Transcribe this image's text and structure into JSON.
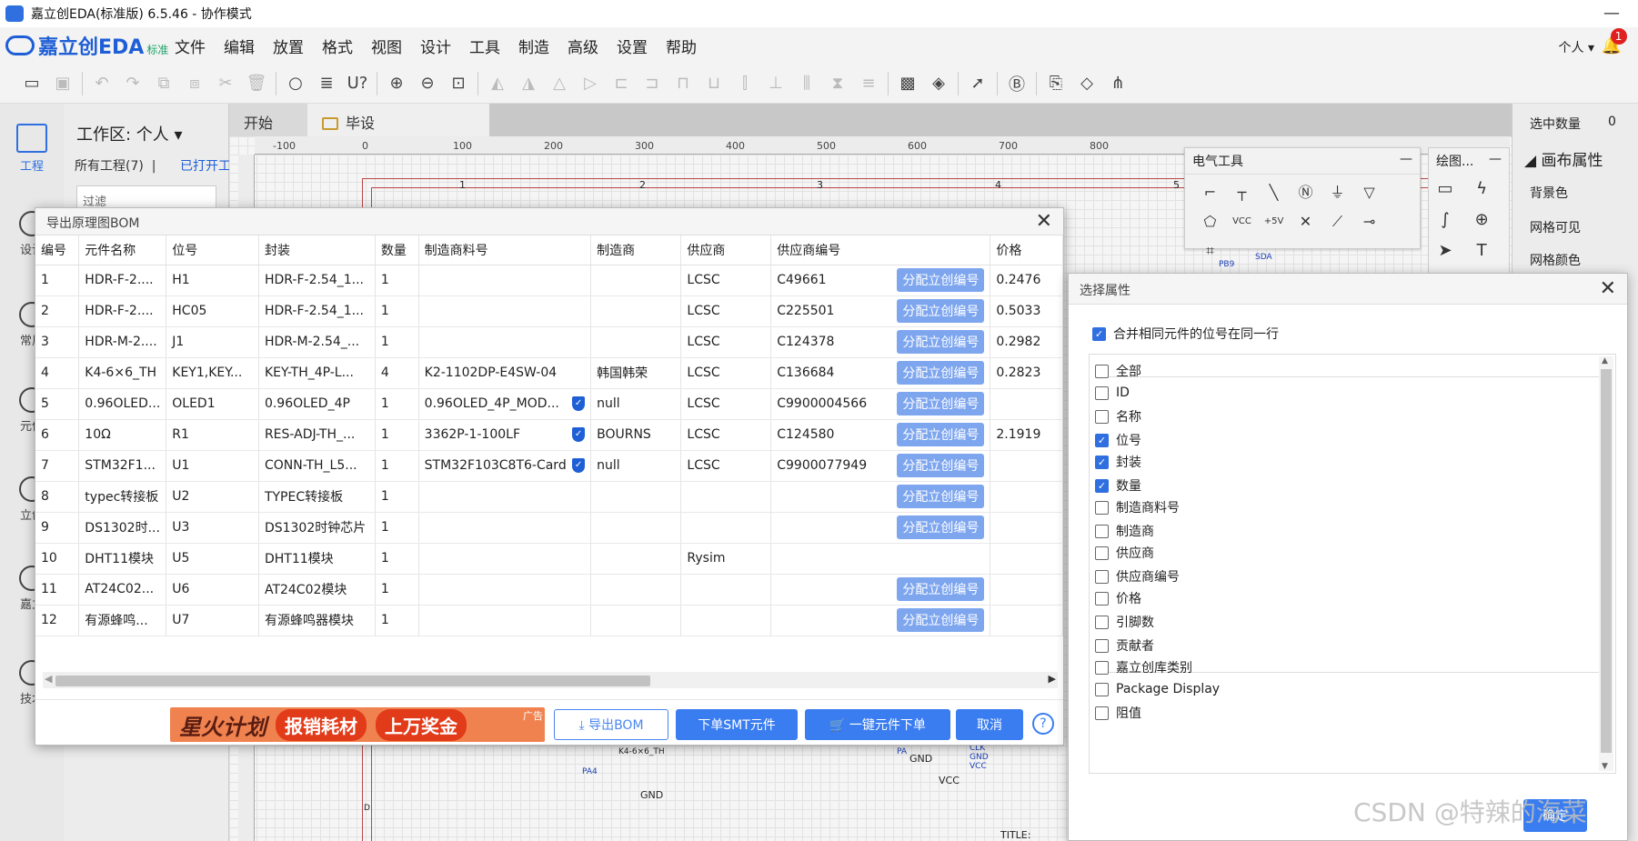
{
  "window": {
    "title": "嘉立创EDA(标准版) 6.5.46 - 协作模式",
    "minimize": "—"
  },
  "brand": {
    "name": "嘉立创EDA",
    "edition": "标准"
  },
  "menu": [
    "文件",
    "编辑",
    "放置",
    "格式",
    "视图",
    "设计",
    "工具",
    "制造",
    "高级",
    "设置",
    "帮助"
  ],
  "user": {
    "label": "个人 ▾",
    "notifications": "1"
  },
  "toolbar_icons": [
    "folder-icon",
    "save-icon",
    "undo-icon",
    "redo-icon",
    "copy-icon",
    "paste-icon",
    "cut-icon",
    "delete-icon",
    "search-icon",
    "find-icon",
    "cross-probe-icon",
    "zoom-in-icon",
    "zoom-out-icon",
    "fit-icon",
    "rotate-left-icon",
    "rotate-right-icon",
    "flip-h-icon",
    "flip-v-icon",
    "align-left-icon",
    "align-right-icon",
    "align-top-icon",
    "align-bottom-icon",
    "align-center-h-icon",
    "align-center-v-icon",
    "distribute-h-icon",
    "distribute-v-icon",
    "snapshot-icon",
    "layers-icon",
    "pointer-icon",
    "bom-icon",
    "export-icon",
    "stack-icon",
    "share-icon"
  ],
  "leftnav": [
    {
      "label": "工程",
      "icon": "project-icon"
    },
    {
      "label": "设计",
      "icon": "design-icon"
    },
    {
      "label": "常用",
      "icon": "common-icon"
    },
    {
      "label": "元件",
      "icon": "component-icon"
    },
    {
      "label": "立创",
      "icon": "lcsc-icon"
    },
    {
      "label": "嘉立",
      "icon": "jlc-icon"
    },
    {
      "label": "技术",
      "icon": "tech-icon"
    }
  ],
  "project_panel": {
    "workspace": "工作区: 个人 ▾",
    "all_projects": "所有工程(7)",
    "separator": "|",
    "opened": "已打开工",
    "filter_placeholder": "过滤"
  },
  "tabs": [
    {
      "label": "开始"
    },
    {
      "label": "毕设"
    }
  ],
  "ruler": {
    "marks": [
      "-100",
      "0",
      "100",
      "200",
      "300",
      "400",
      "500",
      "600",
      "700",
      "800"
    ]
  },
  "schematic": {
    "col_numbers": [
      "1",
      "2",
      "3",
      "4",
      "5"
    ],
    "labels": [
      "PB9",
      "SDA",
      "K4-6×6_TH",
      "PA4",
      "GND",
      "GND",
      "VCC",
      "CLK",
      "GND",
      "VCC",
      "PA",
      "TITLE:",
      "D"
    ]
  },
  "right_panel": {
    "selected_label": "选中数量",
    "selected_value": "0",
    "canvas_props": "画布属性",
    "bg_color": "背景色",
    "grid_visible": "网格可见",
    "grid_color": "网格颜色"
  },
  "elec_tools": {
    "title": "电气工具",
    "items": [
      "wire-icon",
      "bus-icon",
      "line-icon",
      "netlabel-icon",
      "ground-icon",
      "power-icon",
      "netport-icon",
      "vcc-icon",
      "5v-icon",
      "no-connect-icon",
      "probe-icon",
      "pin-icon",
      "component-icon"
    ],
    "vcc_text": "VCC",
    "v5_text": "+5V"
  },
  "draw_tools": {
    "title": "绘图...",
    "items": [
      "image-icon",
      "bolt-icon",
      "arc-icon",
      "circle-plus-icon",
      "arrow-icon",
      "text-icon"
    ]
  },
  "bom_dialog": {
    "title": "导出原理图BOM",
    "columns": [
      "编号",
      "元件名称",
      "位号",
      "封装",
      "数量",
      "制造商料号",
      "制造商",
      "供应商",
      "供应商编号",
      "价格"
    ],
    "assign_label": "分配立创编号",
    "rows": [
      {
        "no": "1",
        "name": "HDR-F-2....",
        "des": "H1",
        "pkg": "HDR-F-2.54_1...",
        "qty": "1",
        "mpn": "",
        "verified": false,
        "mfr": "",
        "sup": "LCSC",
        "supno": "C49661",
        "assign": true,
        "price": "0.2476"
      },
      {
        "no": "2",
        "name": "HDR-F-2....",
        "des": "HC05",
        "pkg": "HDR-F-2.54_1...",
        "qty": "1",
        "mpn": "",
        "verified": false,
        "mfr": "",
        "sup": "LCSC",
        "supno": "C225501",
        "assign": true,
        "price": "0.5033"
      },
      {
        "no": "3",
        "name": "HDR-M-2....",
        "des": "J1",
        "pkg": "HDR-M-2.54_...",
        "qty": "1",
        "mpn": "",
        "verified": false,
        "mfr": "",
        "sup": "LCSC",
        "supno": "C124378",
        "assign": true,
        "price": "0.2982"
      },
      {
        "no": "4",
        "name": "K4-6×6_TH",
        "des": "KEY1,KEY...",
        "pkg": "KEY-TH_4P-L...",
        "qty": "4",
        "mpn": "K2-1102DP-E4SW-04",
        "verified": false,
        "mfr": "韩国韩荣",
        "sup": "LCSC",
        "supno": "C136684",
        "assign": true,
        "price": "0.2823"
      },
      {
        "no": "5",
        "name": "0.96OLED...",
        "des": "OLED1",
        "pkg": "0.96OLED_4P",
        "qty": "1",
        "mpn": "0.96OLED_4P_MOD...",
        "verified": true,
        "mfr": "null",
        "sup": "LCSC",
        "supno": "C9900004566",
        "assign": true,
        "price": ""
      },
      {
        "no": "6",
        "name": "10Ω",
        "des": "R1",
        "pkg": "RES-ADJ-TH_...",
        "qty": "1",
        "mpn": "3362P-1-100LF",
        "verified": true,
        "mfr": "BOURNS",
        "sup": "LCSC",
        "supno": "C124580",
        "assign": true,
        "price": "2.1919"
      },
      {
        "no": "7",
        "name": "STM32F1...",
        "des": "U1",
        "pkg": "CONN-TH_L5...",
        "qty": "1",
        "mpn": "STM32F103C8T6-Card",
        "verified": true,
        "mfr": "null",
        "sup": "LCSC",
        "supno": "C9900077949",
        "assign": true,
        "price": ""
      },
      {
        "no": "8",
        "name": "typec转接板",
        "des": "U2",
        "pkg": "TYPEC转接板",
        "qty": "1",
        "mpn": "",
        "verified": false,
        "mfr": "",
        "sup": "",
        "supno": "",
        "assign": true,
        "price": ""
      },
      {
        "no": "9",
        "name": "DS1302时...",
        "des": "U3",
        "pkg": "DS1302时钟芯片",
        "qty": "1",
        "mpn": "",
        "verified": false,
        "mfr": "",
        "sup": "",
        "supno": "",
        "assign": true,
        "price": ""
      },
      {
        "no": "10",
        "name": "DHT11模块",
        "des": "U5",
        "pkg": "DHT11模块",
        "qty": "1",
        "mpn": "",
        "verified": false,
        "mfr": "",
        "sup": "Rysim",
        "supno": "",
        "assign": false,
        "price": ""
      },
      {
        "no": "11",
        "name": "AT24C02...",
        "des": "U6",
        "pkg": "AT24C02模块",
        "qty": "1",
        "mpn": "",
        "verified": false,
        "mfr": "",
        "sup": "",
        "supno": "",
        "assign": true,
        "price": ""
      },
      {
        "no": "12",
        "name": "有源蜂鸣...",
        "des": "U7",
        "pkg": "有源蜂鸣器模块",
        "qty": "1",
        "mpn": "",
        "verified": false,
        "mfr": "",
        "sup": "",
        "supno": "",
        "assign": true,
        "price": ""
      }
    ],
    "ad": {
      "star": "星火计划",
      "pill1": "报销耗材",
      "pill2": "上万奖金",
      "tag": "广告"
    },
    "buttons": {
      "export": "⤓ 导出BOM",
      "smt": "下单SMT元件",
      "order": "🛒 一键元件下单",
      "cancel": "取消",
      "help": "?"
    },
    "scroll": {
      "left": "◀",
      "right": "▶"
    }
  },
  "props_dialog": {
    "title": "选择属性",
    "merge_label": "合并相同元件的位号在同一行",
    "merge_checked": true,
    "items": [
      {
        "label": "全部",
        "checked": false
      },
      {
        "label": "ID",
        "checked": false
      },
      {
        "label": "名称",
        "checked": false
      },
      {
        "label": "位号",
        "checked": true
      },
      {
        "label": "封装",
        "checked": true
      },
      {
        "label": "数量",
        "checked": true
      },
      {
        "label": "制造商料号",
        "checked": false
      },
      {
        "label": "制造商",
        "checked": false
      },
      {
        "label": "供应商",
        "checked": false
      },
      {
        "label": "供应商编号",
        "checked": false
      },
      {
        "label": "价格",
        "checked": false
      },
      {
        "label": "引脚数",
        "checked": false
      },
      {
        "label": "贡献者",
        "checked": false
      },
      {
        "label": "嘉立创库类别",
        "checked": false
      },
      {
        "label": "Package Display",
        "checked": false
      },
      {
        "label": "阻值",
        "checked": false
      }
    ],
    "ok_label": "确定",
    "scroll_up": "▲",
    "scroll_down": "▼"
  },
  "watermark": "CSDN @特辣的海菜"
}
